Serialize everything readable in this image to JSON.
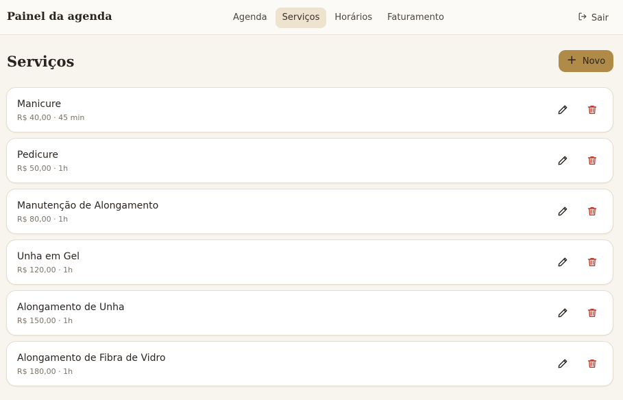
{
  "header": {
    "brand": "Painel da agenda",
    "tabs": [
      {
        "label": "Agenda",
        "active": false
      },
      {
        "label": "Serviços",
        "active": true
      },
      {
        "label": "Horários",
        "active": false
      },
      {
        "label": "Faturamento",
        "active": false
      }
    ],
    "logout_label": "Sair",
    "logout_icon": "logout-icon"
  },
  "main": {
    "title": "Serviços",
    "new_button_label": "Novo",
    "new_button_icon": "plus-icon",
    "services": [
      {
        "name": "Manicure",
        "meta": "R$ 40,00 · 45 min"
      },
      {
        "name": "Pedicure",
        "meta": "R$ 50,00 · 1h"
      },
      {
        "name": "Manutenção de Alongamento",
        "meta": "R$ 80,00 · 1h"
      },
      {
        "name": "Unha em Gel",
        "meta": "R$ 120,00 · 1h"
      },
      {
        "name": "Alongamento de Unha",
        "meta": "R$ 150,00 · 1h"
      },
      {
        "name": "Alongamento de Fibra de Vidro",
        "meta": "R$ 180,00 · 1h"
      }
    ]
  },
  "colors": {
    "background": "#f8f5ee",
    "accent": "#b08a47",
    "active_tab": "#eee3cf",
    "delete": "#c0392b"
  }
}
